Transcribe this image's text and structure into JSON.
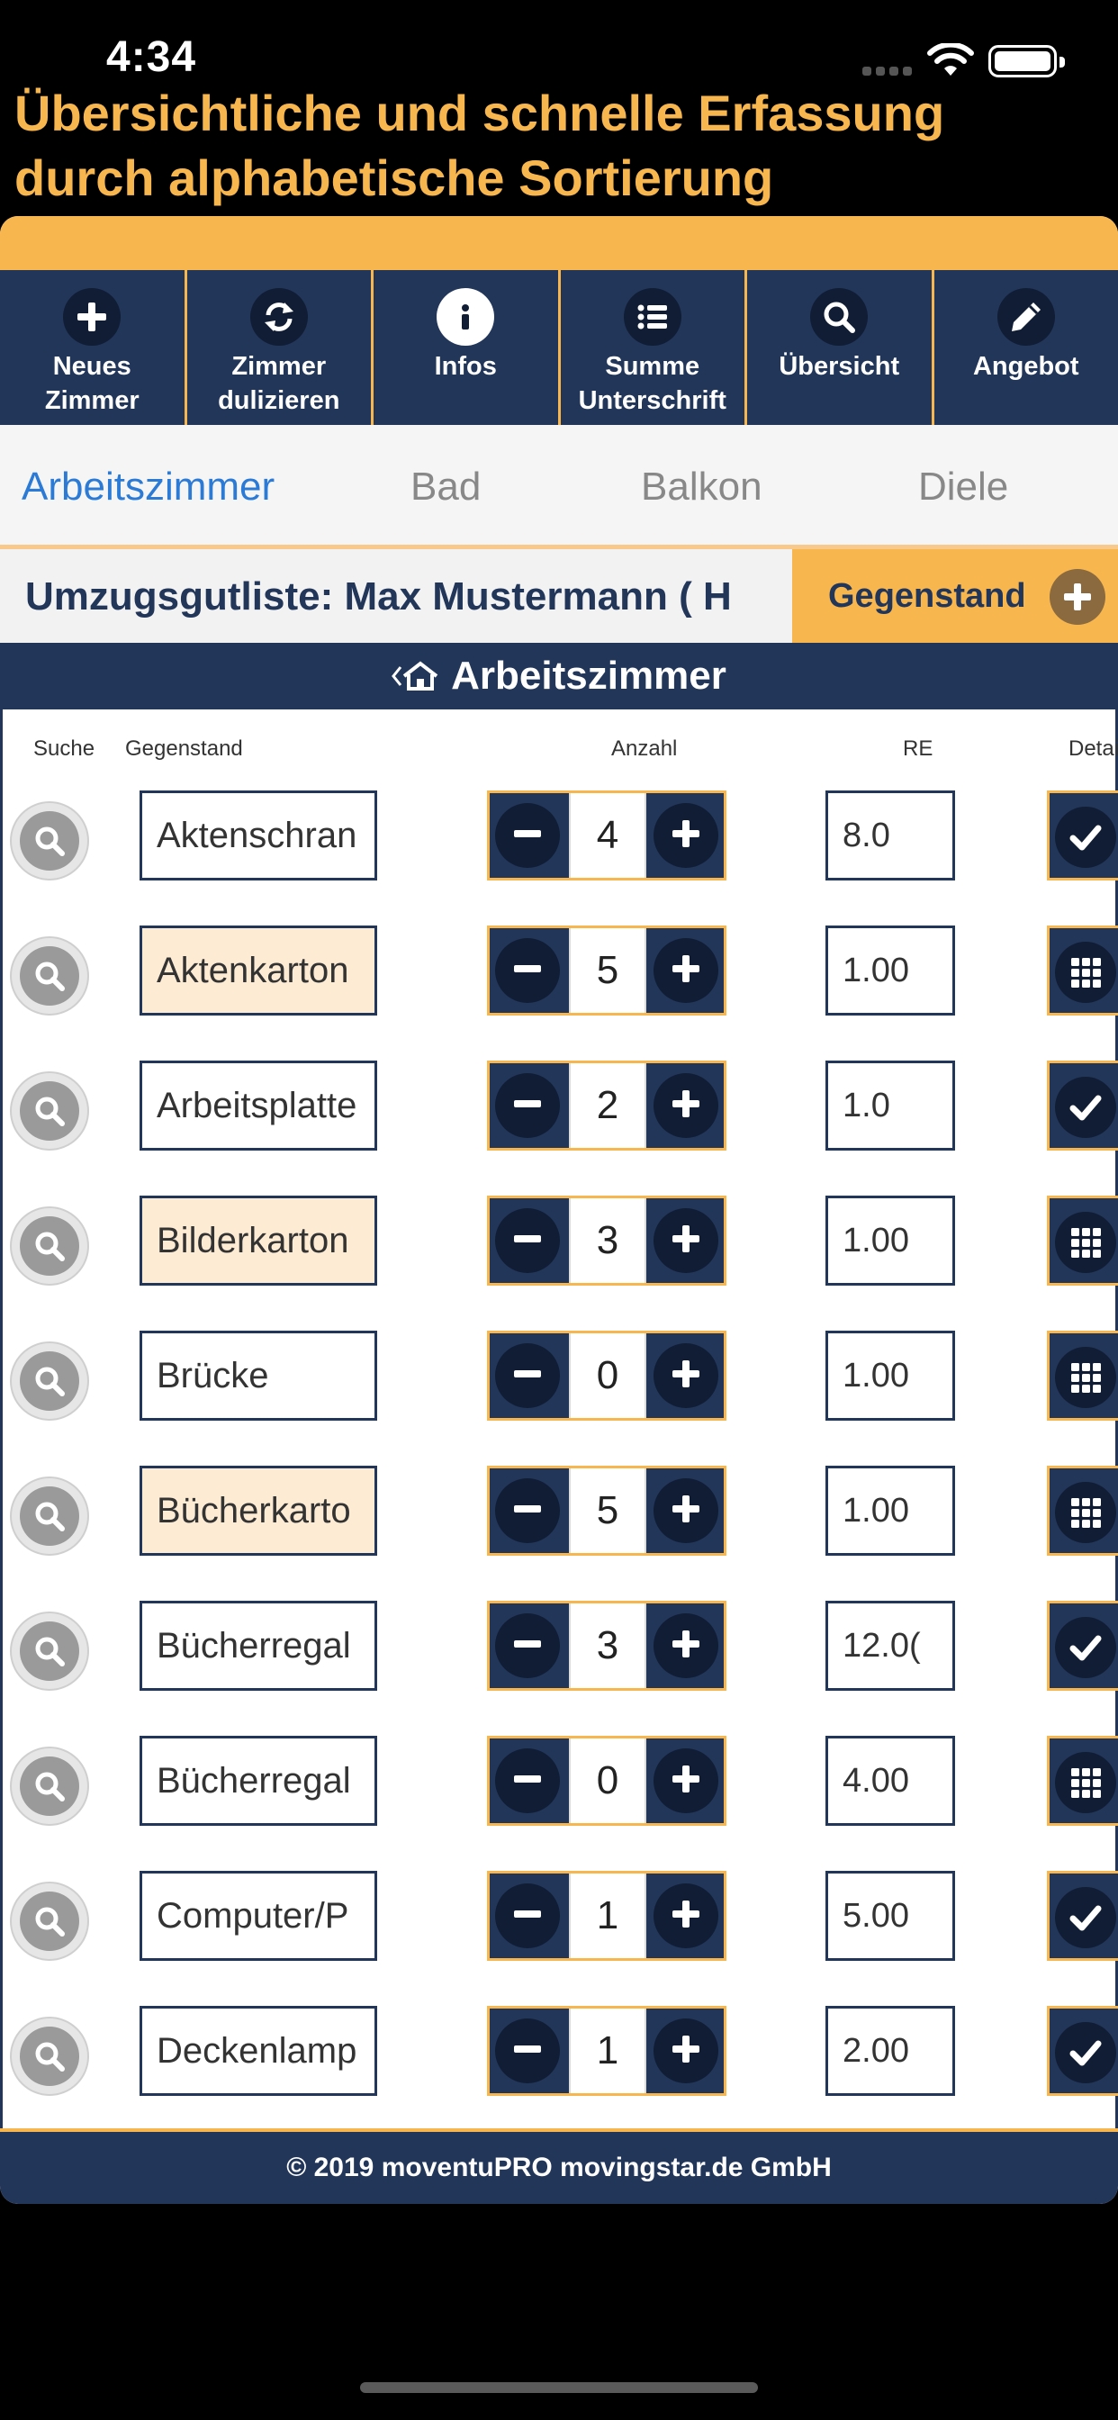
{
  "status": {
    "time": "4:34"
  },
  "headline": {
    "line1": "Übersichtliche und schnelle Erfassung",
    "line2": "durch alphabetische Sortierung"
  },
  "toolbar": [
    {
      "line1": "Neues",
      "line2": "Zimmer",
      "icon": "plus-icon"
    },
    {
      "line1": "Zimmer",
      "line2": "dulizieren",
      "icon": "sync-icon"
    },
    {
      "line1": "Infos",
      "line2": "",
      "icon": "info-icon"
    },
    {
      "line1": "Summe",
      "line2": "Unterschrift",
      "icon": "list-icon"
    },
    {
      "line1": "Übersicht",
      "line2": "",
      "icon": "search-icon"
    },
    {
      "line1": "Angebot",
      "line2": "",
      "icon": "pencil-icon"
    }
  ],
  "tabs": [
    "Arbeitszimmer",
    "Bad",
    "Balkon",
    "Diele"
  ],
  "active_tab": "Arbeitszimmer",
  "list_title": "Umzugsgutliste: Max Mustermann ( H",
  "add_item_label": "Gegenstand",
  "room_title": "Arbeitszimmer",
  "columns": {
    "search": "Suche",
    "item": "Gegenstand",
    "count": "Anzahl",
    "re": "RE",
    "detail": "Detai"
  },
  "items": [
    {
      "name": "Aktenschran",
      "qty": "4",
      "re": "8.0",
      "highlight": false,
      "detail": "check"
    },
    {
      "name": "Aktenkarton",
      "qty": "5",
      "re": "1.00",
      "highlight": true,
      "detail": "grid"
    },
    {
      "name": "Arbeitsplatte",
      "qty": "2",
      "re": "1.0",
      "highlight": false,
      "detail": "check"
    },
    {
      "name": "Bilderkarton",
      "qty": "3",
      "re": "1.00",
      "highlight": true,
      "detail": "grid"
    },
    {
      "name": "Brücke",
      "qty": "0",
      "re": "1.00",
      "highlight": false,
      "detail": "grid"
    },
    {
      "name": "Bücherkarto",
      "qty": "5",
      "re": "1.00",
      "highlight": true,
      "detail": "grid"
    },
    {
      "name": "Bücherregal",
      "qty": "3",
      "re": "12.0(",
      "highlight": false,
      "detail": "check"
    },
    {
      "name": "Bücherregal",
      "qty": "0",
      "re": "4.00",
      "highlight": false,
      "detail": "grid"
    },
    {
      "name": "Computer/P",
      "qty": "1",
      "re": "5.00",
      "highlight": false,
      "detail": "check"
    },
    {
      "name": "Deckenlamp",
      "qty": "1",
      "re": "2.00",
      "highlight": false,
      "detail": "check"
    }
  ],
  "footer": "© 2019 moventuPRO movingstar.de GmbH",
  "colors": {
    "navy": "#22365a",
    "orange": "#f8b64f",
    "highlight": "#fdebd3",
    "active_tab": "#2b7bd6"
  }
}
